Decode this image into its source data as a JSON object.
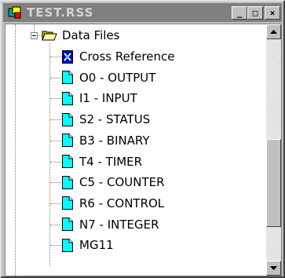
{
  "window": {
    "title": "TEST.RSS",
    "buttons": {
      "minimize": "_",
      "restore": "□",
      "close": "×"
    }
  },
  "tree": {
    "folder": {
      "label": "Data Files",
      "icon": "folder-open-icon",
      "expanded": true
    },
    "items": [
      {
        "label": "Cross Reference",
        "icon": "cross-reference-icon"
      },
      {
        "label": "O0 - OUTPUT",
        "icon": "data-file-icon"
      },
      {
        "label": "I1 - INPUT",
        "icon": "data-file-icon"
      },
      {
        "label": "S2 - STATUS",
        "icon": "data-file-icon"
      },
      {
        "label": "B3 - BINARY",
        "icon": "data-file-icon"
      },
      {
        "label": "T4 - TIMER",
        "icon": "data-file-icon"
      },
      {
        "label": "C5 - COUNTER",
        "icon": "data-file-icon"
      },
      {
        "label": "R6 - CONTROL",
        "icon": "data-file-icon"
      },
      {
        "label": "N7 - INTEGER",
        "icon": "data-file-icon"
      },
      {
        "label": "MG11",
        "icon": "data-file-icon"
      }
    ]
  },
  "colors": {
    "titlebar_inactive": "#808080",
    "file_icon_fill": "#00ffff",
    "folder_fill": "#ffff99"
  }
}
